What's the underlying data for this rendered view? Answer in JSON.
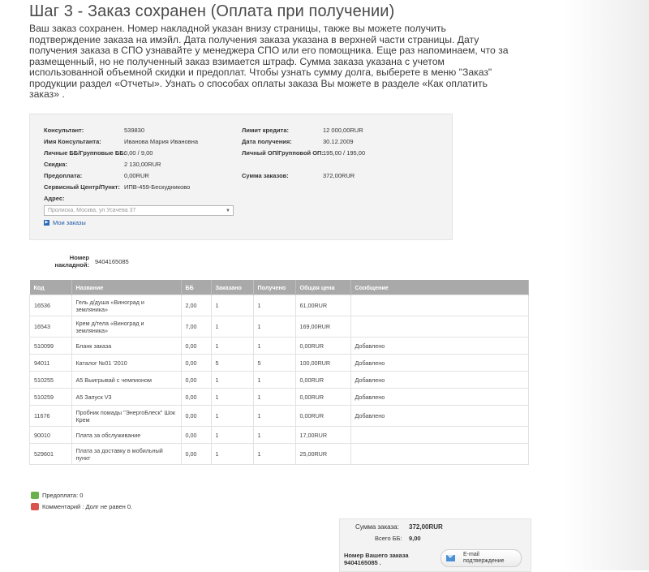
{
  "page": {
    "title": "Шаг 3 - Заказ сохранен (Оплата при получении)",
    "intro": "Ваш заказ сохранен. Номер накладной указан внизу страницы, также вы можете получить подтверждение заказа на имэйл. Дата получения заказа указана в верхней части страницы. Дату получения заказа в СПО узнавайте у менеджера СПО или его помощника. Еще раз напоминаем, что за размещенный, но не полученный заказ взимается штраф. Сумма заказа указана с учетом использованной объемной скидки и предоплат. Чтобы узнать сумму долга, выберете в меню \"Заказ\" продукции раздел «Отчеты». Узнать о способах оплаты заказа Вы можете в разделе «Как оплатить заказ» ."
  },
  "info": {
    "consultant_label": "Консультант:",
    "consultant_value": "539830",
    "name_label": "Имя Консультанта:",
    "name_value": "Иванова Мария Ивановна",
    "bb_label": "Личные ББ/Групповые ББ:",
    "bb_value": "0,00 / 9,00",
    "discount_label": "Скидка:",
    "discount_value": "2 130,00RUR",
    "prepay_label": "Предоплата:",
    "prepay_value": "0,00RUR",
    "service_label": "Сервисный Центр/Пункт:",
    "service_value": "ИПВ-459-Бескудниково",
    "address_label": "Адрес:",
    "address_value": "Пролиска, Москва, ул Усачева 37",
    "credit_label": "Лимит кредита:",
    "credit_value": "12 000,00RUR",
    "date_label": "Дата получения:",
    "date_value": "30.12.2009",
    "op_label": "Личный ОП/Групповой ОП:",
    "op_value": "195,00 / 195,00",
    "orders_sum_label": "Сумма заказов:",
    "orders_sum_value": "372,00RUR",
    "my_orders_link": "Мои заказы"
  },
  "invoice": {
    "label": "Номер накладной:",
    "value": "9404165085"
  },
  "table": {
    "headers": [
      "Код",
      "Название",
      "ББ",
      "Заказано",
      "Получено",
      "Общая цена",
      "Сообщение"
    ],
    "rows": [
      {
        "code": "16536",
        "name": "Гель д/душа «Виноград и земляника»",
        "bb": "2,00",
        "ordered": "1",
        "received": "1",
        "price": "61,00RUR",
        "message": ""
      },
      {
        "code": "16543",
        "name": "Крем д/тела «Виноград и земляника»",
        "bb": "7,00",
        "ordered": "1",
        "received": "1",
        "price": "169,00RUR",
        "message": ""
      },
      {
        "code": "510099",
        "name": "Бланк заказа",
        "bb": "0,00",
        "ordered": "1",
        "received": "1",
        "price": "0,00RUR",
        "message": "Добавлено"
      },
      {
        "code": "94011",
        "name": "Каталог №01 '2010",
        "bb": "0,00",
        "ordered": "5",
        "received": "5",
        "price": "100,00RUR",
        "message": "Добавлено"
      },
      {
        "code": "510255",
        "name": "А5 Выигрывай с чемпионом",
        "bb": "0,00",
        "ordered": "1",
        "received": "1",
        "price": "0,00RUR",
        "message": "Добавлено"
      },
      {
        "code": "510259",
        "name": "А5 Запуск V3",
        "bb": "0,00",
        "ordered": "1",
        "received": "1",
        "price": "0,00RUR",
        "message": "Добавлено"
      },
      {
        "code": "11676",
        "name": "Пробник помады \"ЭнергоБлеск\" Шок Крем",
        "bb": "0,00",
        "ordered": "1",
        "received": "1",
        "price": "0,00RUR",
        "message": "Добавлено"
      },
      {
        "code": "90010",
        "name": "Плата за обслуживание",
        "bb": "0,00",
        "ordered": "1",
        "received": "1",
        "price": "17,00RUR",
        "message": ""
      },
      {
        "code": "529601",
        "name": "Плата за доставку в мобильный пункт",
        "bb": "0,00",
        "ordered": "1",
        "received": "1",
        "price": "25,00RUR",
        "message": ""
      }
    ]
  },
  "legend": {
    "prepay": "Предоплата: 0",
    "comment": "Комментарий : Долг не равен 0."
  },
  "summary": {
    "total_label": "Сумма заказа:",
    "total_value": "372,00RUR",
    "bb_label": "Всего ББ:",
    "bb_value": "9,00",
    "order_number_label": "Номер Вашего заказа",
    "order_number_value": "9404165085 .",
    "email_button": "E-mail подтверждение"
  },
  "colors": {
    "table_header": "#a9a9a9",
    "link": "#1f5aa6",
    "prepay_icon": "#6ab04c",
    "comment_icon": "#d9534f"
  }
}
